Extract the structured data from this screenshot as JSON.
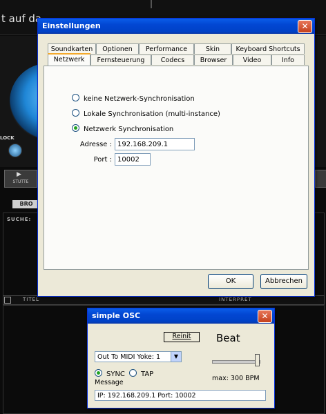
{
  "background_app": {
    "title": "t auf da",
    "clock_label": "LOCK",
    "stutter_label": "STUTTE",
    "browse_tab": "BRO",
    "search_label": "SUCHE:",
    "columns": {
      "title": "TITEL",
      "interpret": "INTERPRET"
    }
  },
  "settings": {
    "title": "Einstellungen",
    "tabs_row1": [
      "Soundkarten",
      "Optionen",
      "Performance",
      "Skin",
      "Keyboard Shortcuts"
    ],
    "tabs_row2": [
      "Netzwerk",
      "Fernsteuerung",
      "Codecs",
      "Browser",
      "Video",
      "Info"
    ],
    "active_tab": "Netzwerk",
    "options": [
      {
        "label": "keine Netzwerk-Synchronisation",
        "selected": false
      },
      {
        "label": "Lokale Synchronisation (multi-instance)",
        "selected": false
      },
      {
        "label": "Netzwerk Synchronisation",
        "selected": true
      }
    ],
    "address_label": "Adresse :",
    "address_value": "192.168.209.1",
    "port_label": "Port :",
    "port_value": "10002",
    "ok_label": "OK",
    "cancel_label": "Abbrechen"
  },
  "osc": {
    "title": "simple OSC",
    "reinit_label": "Reinit",
    "beat_label": "Beat",
    "midi_select": "Out To MIDI Yoke:  1",
    "sync_label": "SYNC",
    "tap_label": "TAP",
    "sync_selected": true,
    "max_bpm": "max: 300 BPM",
    "message_label": "Message",
    "message_value": "IP: 192.168.209.1  Port: 10002"
  },
  "colors": {
    "titlebar": "#0246d2",
    "dialog_bg": "#ece9d8",
    "close_button": "#c4401c"
  }
}
